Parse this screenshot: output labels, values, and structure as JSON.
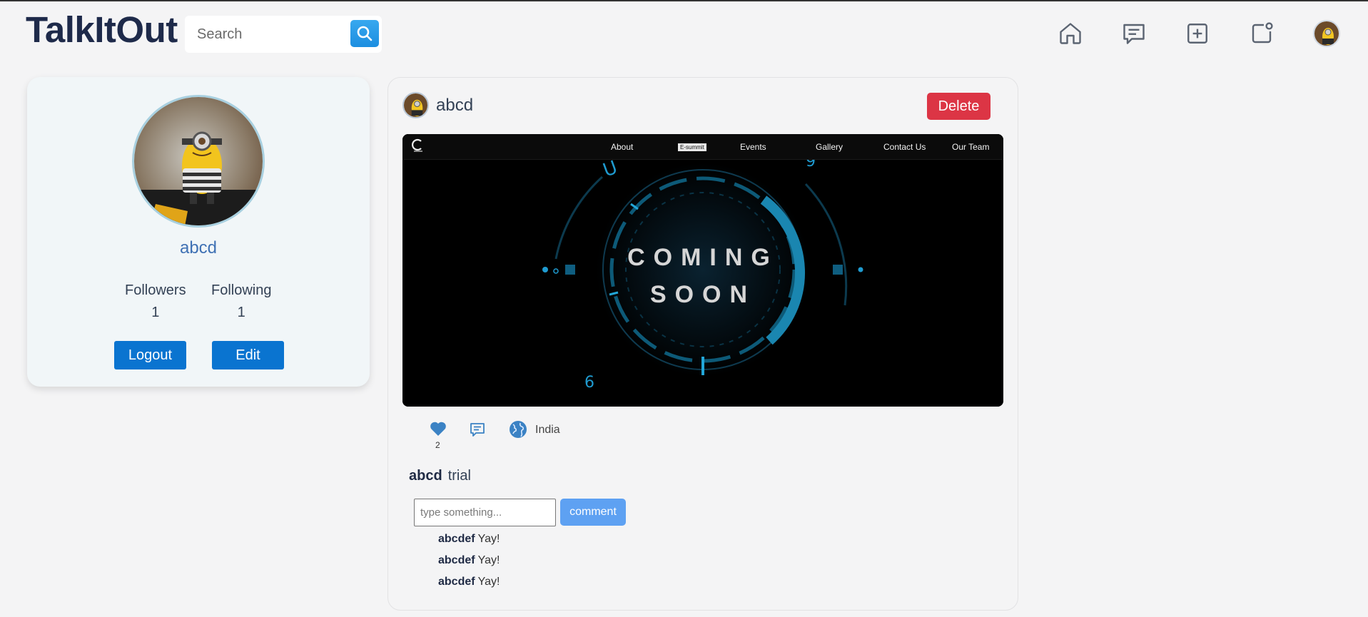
{
  "header": {
    "brand": "TalkItOut",
    "search_placeholder": "Search",
    "nav_icons": [
      "home-icon",
      "messages-icon",
      "add-post-icon",
      "notifications-icon",
      "profile-avatar"
    ]
  },
  "profile": {
    "name": "abcd",
    "followers_label": "Followers",
    "followers_count": "1",
    "following_label": "Following",
    "following_count": "1",
    "logout_label": "Logout",
    "edit_label": "Edit"
  },
  "post": {
    "username": "abcd",
    "delete_label": "Delete",
    "image": {
      "nav_items": [
        "About",
        "E-summit",
        "Events",
        "Gallery",
        "Contact Us",
        "Our Team"
      ],
      "line1": "COMING",
      "line2": "SOON"
    },
    "likes": "2",
    "location": "India",
    "caption_user": "abcd",
    "caption_text": "trial",
    "comment_placeholder": "type something...",
    "comment_button": "comment",
    "comments": [
      {
        "user": "abcdef",
        "text": "Yay!"
      },
      {
        "user": "abcdef",
        "text": "Yay!"
      },
      {
        "user": "abcdef",
        "text": "Yay!"
      }
    ]
  },
  "colors": {
    "brand": "#1e2a4a",
    "primary_button": "#0a74d0",
    "delete_button": "#dc3545",
    "comment_button": "#5ea1f2",
    "icon_blue": "#3b82c4"
  }
}
